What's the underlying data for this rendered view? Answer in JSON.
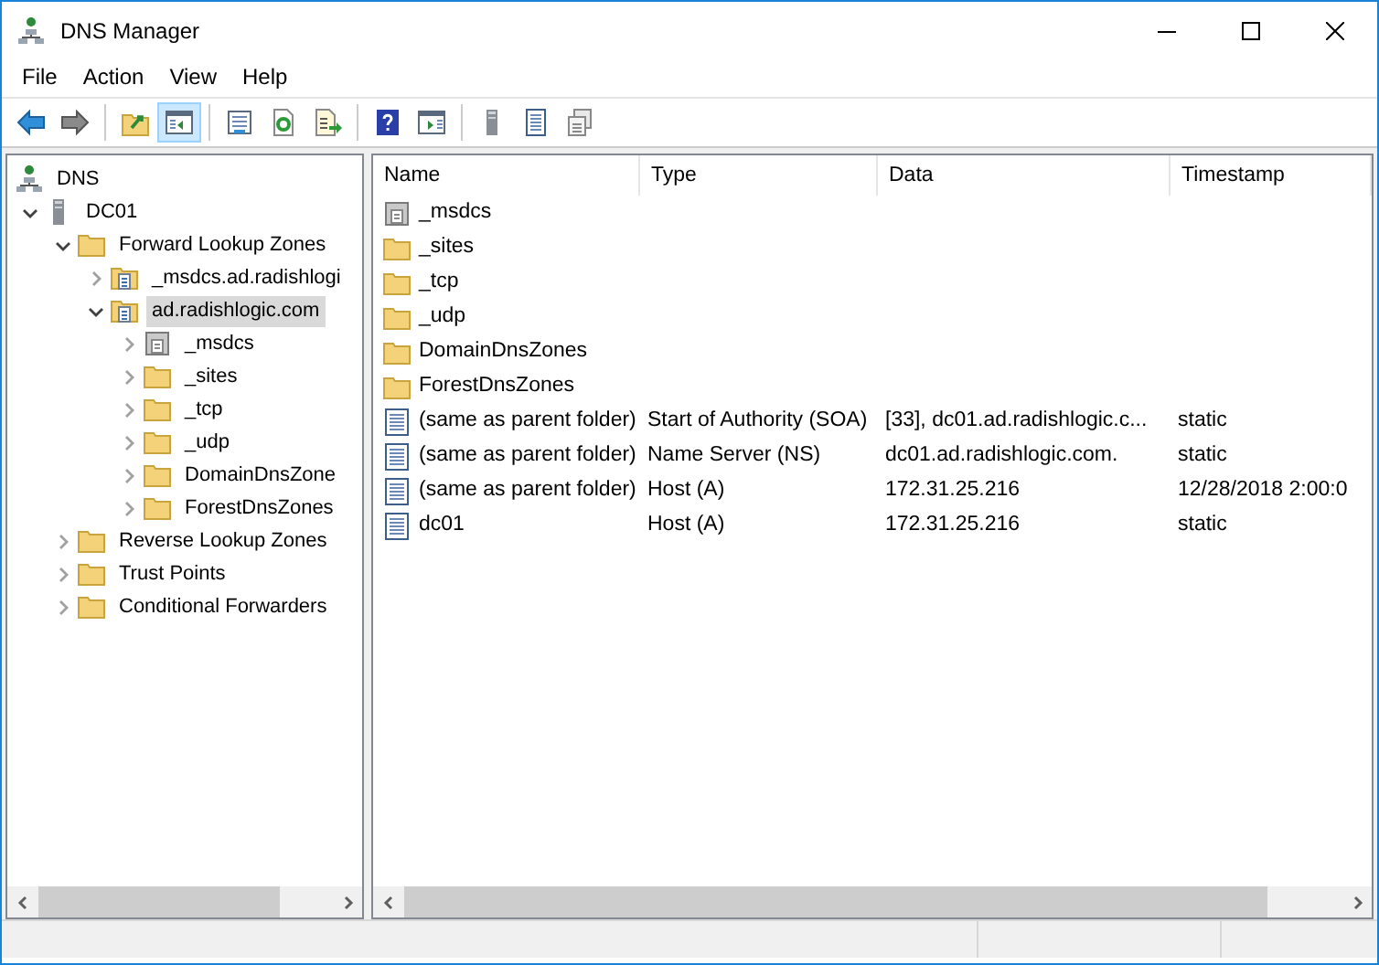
{
  "window": {
    "title": "DNS Manager"
  },
  "menu": [
    "File",
    "Action",
    "View",
    "Help"
  ],
  "toolbar": [
    [
      {
        "kind": "back",
        "pressed": false
      },
      {
        "kind": "forward",
        "pressed": false
      }
    ],
    [
      {
        "kind": "up",
        "pressed": false
      },
      {
        "kind": "tree",
        "pressed": true
      }
    ],
    [
      {
        "kind": "properties",
        "pressed": false
      },
      {
        "kind": "refresh",
        "pressed": false
      },
      {
        "kind": "export",
        "pressed": false
      }
    ],
    [
      {
        "kind": "help",
        "pressed": false
      },
      {
        "kind": "actionpane",
        "pressed": false
      }
    ],
    [
      {
        "kind": "server",
        "pressed": false
      },
      {
        "kind": "list",
        "pressed": false
      },
      {
        "kind": "copy",
        "pressed": false
      }
    ]
  ],
  "tree": [
    {
      "label": "DNS",
      "kind": "dns",
      "selected": false,
      "children": [
        {
          "label": "DC01",
          "kind": "server",
          "expanded": true,
          "selected": false,
          "children": [
            {
              "label": "Forward Lookup Zones",
              "kind": "folder",
              "expanded": true,
              "selected": false,
              "children": [
                {
                  "label": "_msdcs.ad.radishlogi",
                  "kind": "zone",
                  "expanded": false,
                  "selected": false
                },
                {
                  "label": "ad.radishlogic.com",
                  "kind": "zone",
                  "expanded": true,
                  "selected": true,
                  "children": [
                    {
                      "label": "_msdcs",
                      "kind": "delegation",
                      "expanded": false,
                      "selected": false
                    },
                    {
                      "label": "_sites",
                      "kind": "folder",
                      "expanded": false,
                      "selected": false
                    },
                    {
                      "label": "_tcp",
                      "kind": "folder",
                      "expanded": false,
                      "selected": false
                    },
                    {
                      "label": "_udp",
                      "kind": "folder",
                      "expanded": false,
                      "selected": false
                    },
                    {
                      "label": "DomainDnsZone",
                      "kind": "folder",
                      "expanded": false,
                      "selected": false
                    },
                    {
                      "label": "ForestDnsZones",
                      "kind": "folder",
                      "expanded": false,
                      "selected": false
                    }
                  ]
                }
              ]
            },
            {
              "label": "Reverse Lookup Zones",
              "kind": "folder",
              "expanded": false,
              "selected": false
            },
            {
              "label": "Trust Points",
              "kind": "folder",
              "expanded": false,
              "selected": false
            },
            {
              "label": "Conditional Forwarders",
              "kind": "folder",
              "expanded": false,
              "selected": false
            }
          ]
        }
      ]
    }
  ],
  "table": {
    "columns": [
      "Name",
      "Type",
      "Data",
      "Timestamp"
    ],
    "rows": [
      {
        "kind": "delegation",
        "cells": [
          "_msdcs"
        ]
      },
      {
        "kind": "folder",
        "cells": [
          "_sites"
        ]
      },
      {
        "kind": "folder",
        "cells": [
          "_tcp"
        ]
      },
      {
        "kind": "folder",
        "cells": [
          "_udp"
        ]
      },
      {
        "kind": "folder",
        "cells": [
          "DomainDnsZones"
        ]
      },
      {
        "kind": "folder",
        "cells": [
          "ForestDnsZones"
        ]
      },
      {
        "kind": "record",
        "cells": [
          "(same as parent folder)",
          "Start of Authority (SOA)",
          "[33], dc01.ad.radishlogic.c...",
          "static"
        ]
      },
      {
        "kind": "record",
        "cells": [
          "(same as parent folder)",
          "Name Server (NS)",
          "dc01.ad.radishlogic.com.",
          "static"
        ]
      },
      {
        "kind": "record",
        "cells": [
          "(same as parent folder)",
          "Host (A)",
          "172.31.25.216",
          "12/28/2018 2:00:0"
        ]
      },
      {
        "kind": "record",
        "cells": [
          "dc01",
          "Host (A)",
          "172.31.25.216",
          "static"
        ]
      }
    ]
  }
}
